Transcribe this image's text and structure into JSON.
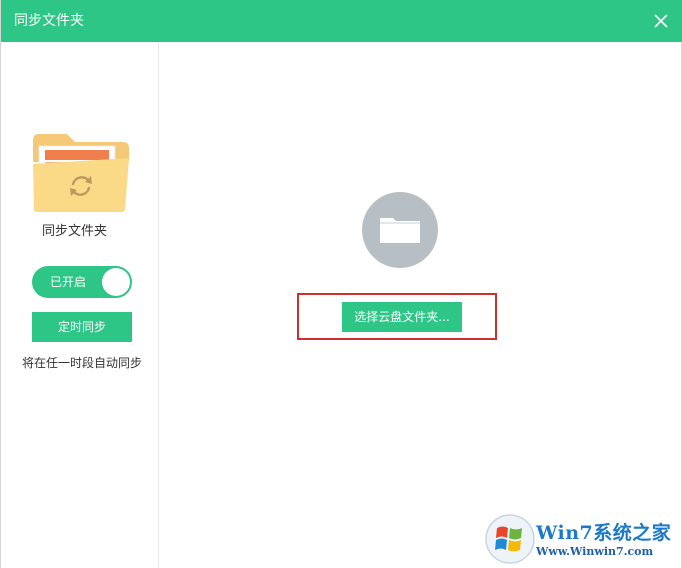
{
  "window": {
    "title": "同步文件夹"
  },
  "sidebar": {
    "folder_name": "同步文件夹",
    "toggle_label": "已开启",
    "timer_button": "定时同步",
    "auto_desc": "将在任一时段自动同步"
  },
  "main": {
    "select_button": "选择云盘文件夹..."
  },
  "watermark": {
    "title": "Win7系统之家",
    "url": "Www.Winwin7.com"
  },
  "icons": {
    "close": "close-icon",
    "folder": "folder-sync-icon",
    "empty_folder": "folder-icon",
    "logo": "windows-logo-icon"
  },
  "colors": {
    "accent": "#2ec687",
    "highlight": "#d12e2e",
    "icon_circle": "#b7bfc5"
  }
}
